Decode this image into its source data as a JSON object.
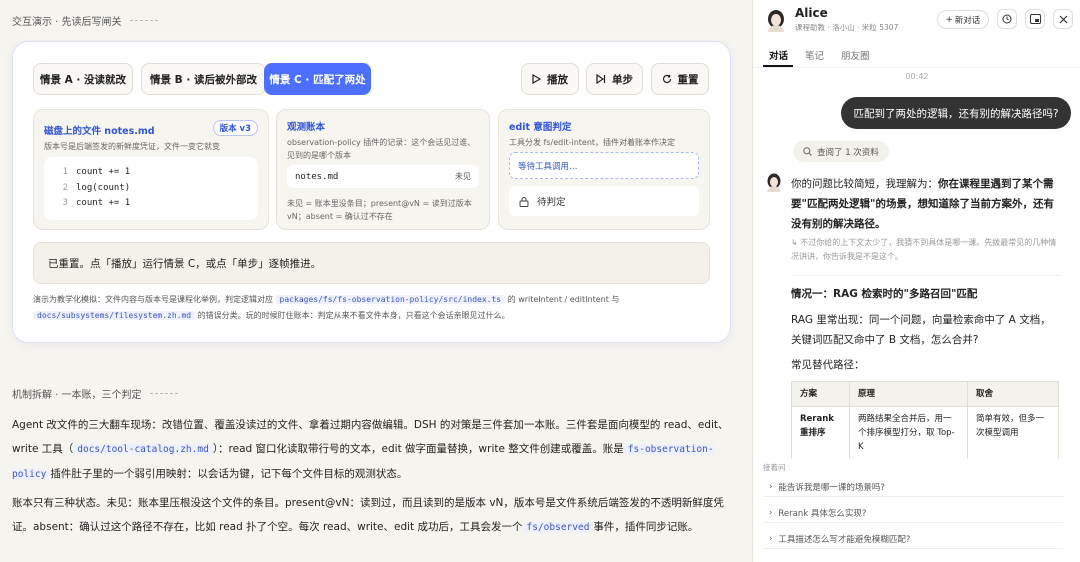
{
  "demo_section": {
    "label": "交互演示 · 先读后写闸关"
  },
  "controls": {
    "scenario_a": "情景 A · 没读就改",
    "scenario_b": "情景 B · 读后被外部改",
    "scenario_c": "情景 C · 匹配了两处",
    "play": "播放",
    "step": "单步",
    "reset": "重置"
  },
  "disk_panel": {
    "title": "磁盘上的文件 notes.md",
    "badge": "版本 v3",
    "desc": "版本号是后端签发的新鲜度凭证，文件一变它就变",
    "code": [
      {
        "n": "1",
        "text": "count += 1"
      },
      {
        "n": "2",
        "text": "log(count)"
      },
      {
        "n": "3",
        "text": "count += 1"
      }
    ]
  },
  "ledger_panel": {
    "title": "观测账本",
    "desc": "observation-policy 插件的记录：这个会话见过谁、见到的是哪个版本",
    "file": "notes.md",
    "state": "未见",
    "legend": "未见 = 账本里没条目；present@vN = 读到过版本 vN；absent = 确认过不存在"
  },
  "edit_panel": {
    "title": "edit 意图判定",
    "desc": "工具分发 fs/edit-intent，插件对着账本作决定",
    "waiting": "等待工具调用…",
    "pending": "待判定"
  },
  "status_text": "已重置。点「播放」运行情景 C，或点「单步」逐帧推进。",
  "note": {
    "p1": "演示为教学化模拟：文件内容与版本号是课程化举例，判定逻辑对应",
    "c1": "packages/fs/fs-observation-policy/src/index.ts",
    "p2": "的 writeIntent / editIntent 与",
    "c2": "docs/subsystems/filesystem.zh.md",
    "p3": "的错误分类。玩的时候盯住账本：判定从来不看文件本身，只看这个会话亲眼见过什么。"
  },
  "mech_section": {
    "label": "机制拆解 · 一本账，三个判定"
  },
  "para1": {
    "a": "Agent 改文件的三大翻车现场：改错位置、覆盖没读过的文件、拿着过期内容做编辑。DSH 的对策是三件套加一本账。三件套是面向模型的 read、edit、write 工具（",
    "chip1": "docs/tool-catalog.zh.md",
    "b": "）：read 窗口化读取带行号的文本，edit 做字面量替换，write 整文件创建或覆盖。账是",
    "chip2": "fs-observation-policy",
    "c": "插件肚子里的一个弱引用映射：以会话为键，记下每个文件目标的观测状态。"
  },
  "para2": {
    "a": "账本只有三种状态。未见：账本里压根没这个文件的条目。present@vN：读到过，而且读到的是版本 vN，版本号是文件系统后端签发的不透明新鲜度凭证。absent：确认过这个路径不存在，比如 read 扑了个空。每次 read、write、edit 成功后，工具会发一个",
    "chip": "fs/observed",
    "b": "事件，插件同步记账。"
  },
  "chat": {
    "name": "Alice",
    "subtitle": "课程助教 · 洛小山 · 米粒 5307",
    "new_chat": "新对话",
    "tabs": [
      "对话",
      "笔记",
      "朋友圈"
    ],
    "time": "00:42",
    "user_msg": "匹配到了两处的逻辑，还有别的解决路径吗?",
    "tool_note": "查阅了 1 次资料",
    "reply_a": "你的问题比较简短，我理解为：",
    "reply_b": "你在课程里遇到了某个需要\"匹配两处逻辑\"的场景，想知道除了当前方案外，还有没有别的解决路径。",
    "aside": "不过你给的上下文太少了，我猜不到具体是哪一课。先拨最常见的几种情况讲讲，你告诉我是不是这个。",
    "case_title": "情况一：RAG 检索时的\"多路召回\"匹配",
    "case_body": "RAG 里常出现：同一个问题，向量检索命中了 A 文档，关键词匹配又命中了 B 文档，怎么合并?",
    "alt_label": "常见替代路径：",
    "table": {
      "headers": [
        "方案",
        "原理",
        "取舍"
      ],
      "rows": [
        [
          "Rerank 重排序",
          "两路结果全合并后，用一个排序模型打分，取 Top-K",
          "简单有效，但多一次模型调用"
        ]
      ]
    },
    "follow_label": "接着问",
    "suggestions": [
      "能告诉我是哪一课的场景吗?",
      "Rerank 具体怎么实现?",
      "工具描述怎么写才能避免模糊匹配?"
    ]
  }
}
